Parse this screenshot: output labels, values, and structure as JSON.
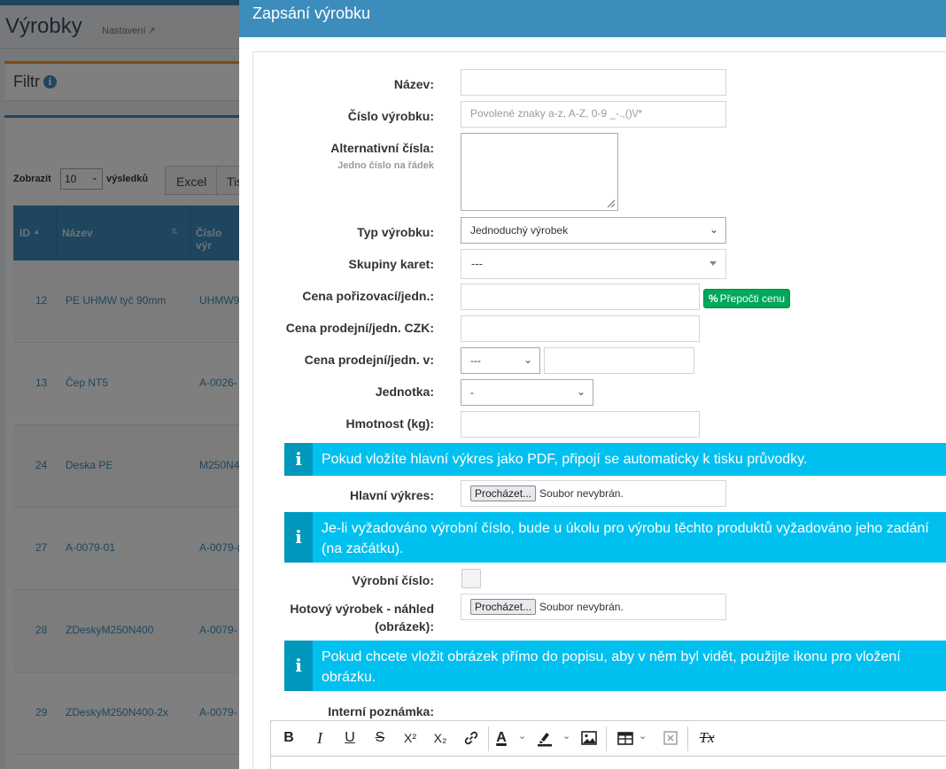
{
  "background": {
    "page_title": "Výrobky",
    "settings_link": "Nastavení",
    "filter_title": "Filtr",
    "show_label": "Zobrazit",
    "show_value": "10",
    "results_label": "výsledků",
    "buttons": [
      "Excel",
      "Tis"
    ],
    "columns": [
      "ID",
      "Název",
      "Číslo výr"
    ],
    "rows": [
      {
        "id": "12",
        "name": "PE UHMW tyč 90mm",
        "code": "UHMW9"
      },
      {
        "id": "13",
        "name": "Čep NT5",
        "code": "A-0026-"
      },
      {
        "id": "24",
        "name": "Deska PE",
        "code": "M250N4"
      },
      {
        "id": "27",
        "name": "A-0079-01",
        "code": "A-0079-("
      },
      {
        "id": "28",
        "name": "ZDeskyM250N400",
        "code": "A-0079-"
      },
      {
        "id": "29",
        "name": "ZDeskyM250N400-2x",
        "code": "A-0079-"
      }
    ]
  },
  "modal": {
    "title": "Zapsání výrobku",
    "fields": {
      "name_label": "Název:",
      "code_label": "Číslo výrobku:",
      "code_placeholder": "Povolené znaky a-z, A-Z, 0-9 _-.,()\\/*",
      "alt_label": "Alternativní čísla:",
      "alt_hint": "Jedno číslo na řádek",
      "type_label": "Typ výrobku:",
      "type_value": "Jednoduchý výrobek",
      "groups_label": "Skupiny karet:",
      "groups_value": "---",
      "purchase_label": "Cena pořizovací/jedn.:",
      "recalc_button": "Přepočti cenu",
      "sale_czk_label": "Cena prodejní/jedn. CZK:",
      "sale_in_label": "Cena prodejní/jedn. v:",
      "sale_currency_value": "---",
      "unit_label": "Jednotka:",
      "unit_value": "-",
      "weight_label": "Hmotnost (kg):",
      "main_drawing_label": "Hlavní výkres:",
      "browse_button": "Procházet...",
      "no_file": "Soubor nevybrán.",
      "serial_label": "Výrobní číslo:",
      "preview_label_1": "Hotový výrobek - náhled",
      "preview_label_2": "(obrázek):",
      "note_label": "Interní poznámka:"
    },
    "callouts": {
      "pdf": "Pokud vložíte hlavní výkres jako PDF, připojí se automaticky k tisku průvodky.",
      "serial": "Je-li vyžadováno výrobní číslo, bude u úkolu pro výrobu těchto produktů vyžadováno jeho zadání (na začátku).",
      "image": "Pokud chcete vložit obrázek přímo do popisu, aby v něm byl vidět, použijte ikonu pro vložení obrázku."
    },
    "toolbar": {
      "bold": "B",
      "italic": "I",
      "underline": "U",
      "strike": "S",
      "superscript": "X²",
      "subscript": "X₂",
      "text_color": "A",
      "clear_format": "Tx"
    }
  },
  "colors": {
    "primary": "#3c8dbc",
    "info": "#00c0ef",
    "info_dark": "#0097bc",
    "success": "#00a65a",
    "warning": "#f39c12"
  }
}
